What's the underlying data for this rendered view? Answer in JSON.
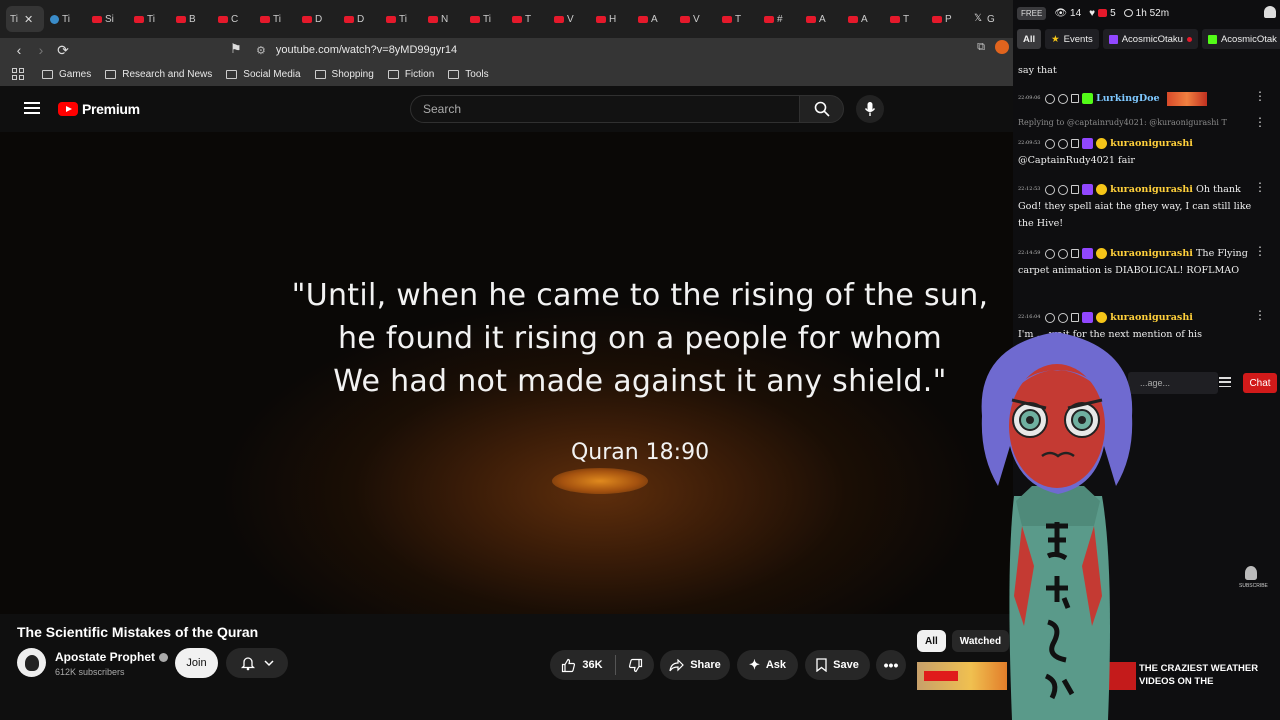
{
  "browser": {
    "tabs": [
      {
        "label": "Ti",
        "fav": "red",
        "active": true
      },
      {
        "label": "Ti",
        "fav": "blue"
      },
      {
        "label": "Si",
        "fav": "red"
      },
      {
        "label": "Ti",
        "fav": "red"
      },
      {
        "label": "B",
        "fav": "red"
      },
      {
        "label": "C",
        "fav": "red"
      },
      {
        "label": "Ti",
        "fav": "red"
      },
      {
        "label": "D",
        "fav": "red"
      },
      {
        "label": "D",
        "fav": "red"
      },
      {
        "label": "Ti",
        "fav": "red"
      },
      {
        "label": "N",
        "fav": "red"
      },
      {
        "label": "Ti",
        "fav": "red"
      },
      {
        "label": "T",
        "fav": "red"
      },
      {
        "label": "V",
        "fav": "red"
      },
      {
        "label": "H",
        "fav": "red"
      },
      {
        "label": "A",
        "fav": "red"
      },
      {
        "label": "V",
        "fav": "red"
      },
      {
        "label": "T",
        "fav": "red"
      },
      {
        "label": "#",
        "fav": "red"
      },
      {
        "label": "A",
        "fav": "red"
      },
      {
        "label": "A",
        "fav": "red"
      },
      {
        "label": "T",
        "fav": "red"
      },
      {
        "label": "P",
        "fav": "red"
      },
      {
        "label": "G",
        "fav": "x"
      }
    ],
    "url": "youtube.com/watch?v=8yMD99gyr14",
    "bookmarks": [
      "Games",
      "Research and News",
      "Social Media",
      "Shopping",
      "Fiction",
      "Tools"
    ]
  },
  "youtube": {
    "brand": "Premium",
    "search_placeholder": "Search",
    "quote_lines": [
      "\"Until, when he came to the rising of the sun,",
      "he found it rising on a people for whom",
      "We had not made against it any shield.\""
    ],
    "quote_ref": "Quran 18:90",
    "video_title": "The Scientific Mistakes of the Quran",
    "channel": "Apostate Prophet",
    "subscribers": "612K subscribers",
    "join_label": "Join",
    "likes": "36K",
    "share_label": "Share",
    "ask_label": "Ask",
    "save_label": "Save",
    "chips": [
      "All",
      "Watched"
    ],
    "rec_title": "THE CRAZIEST WEATHER VIDEOS ON THE"
  },
  "stream_panel": {
    "free_label": "FREE",
    "viewers": "14",
    "likes": "5",
    "uptime": "1h 52m",
    "tabs": [
      "All",
      "Events",
      "AcosmicOtaku",
      "AcosmicOtak"
    ],
    "messages": [
      {
        "time": "",
        "user": "",
        "text": "say that"
      },
      {
        "time": "22:09:06",
        "user": "LurkingDoe",
        "text": ""
      },
      {
        "reply": "Replying to @captainrudy4021: @kuraonigurashi T"
      },
      {
        "time": "22:09:53",
        "user": "kuraonigurashi",
        "text": "@CaptainRudy4021 fair"
      },
      {
        "time": "22:12:53",
        "user": "kuraonigurashi",
        "text": "Oh thank God! they spell aiat the ghey way, I can still like the Hive!"
      },
      {
        "time": "22:14:59",
        "user": "kuraonigurashi",
        "text": "The Flying carpet animation is DIABOLICAL! ROFLMAO"
      },
      {
        "time": "22:16:04",
        "user": "kuraonigurashi",
        "text": "I'm ... wait for the next mention of his"
      }
    ],
    "chat_placeholder": "...age...",
    "chat_button": "Chat",
    "subscribe_label": "SUBSCRIBE"
  },
  "colors": {
    "accent": "#ff0000",
    "chat_button": "#d11a1a",
    "username": "#ffd03b",
    "twitch": "#9147ff",
    "kick": "#53fc18"
  }
}
